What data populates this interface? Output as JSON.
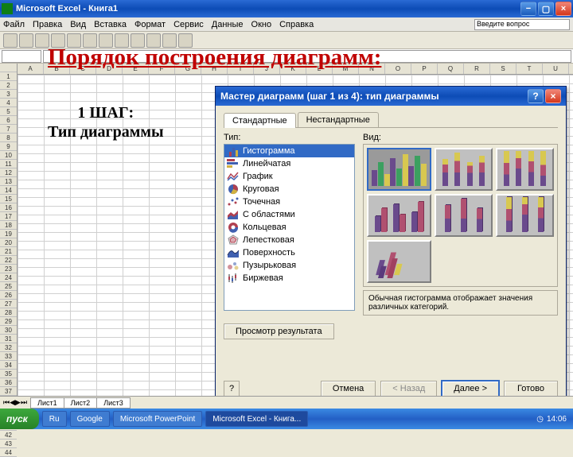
{
  "window": {
    "title": "Microsoft Excel - Книга1",
    "question_dropdown": "Введите вопрос"
  },
  "menu": [
    "Файл",
    "Правка",
    "Вид",
    "Вставка",
    "Формат",
    "Сервис",
    "Данные",
    "Окно",
    "Справка"
  ],
  "columns": [
    "A",
    "B",
    "C",
    "D",
    "E",
    "F",
    "G",
    "H",
    "I",
    "J",
    "K",
    "L",
    "M",
    "N",
    "O",
    "P",
    "Q",
    "R",
    "S",
    "T",
    "U"
  ],
  "slide": {
    "title": "Порядок построения диаграмм:",
    "step1_label": "1 ШАГ:",
    "step1_text": "Тип диаграммы"
  },
  "wizard": {
    "title": "Мастер диаграмм (шаг 1 из 4): тип диаграммы",
    "tabs": {
      "std": "Стандартные",
      "custom": "Нестандартные"
    },
    "labels": {
      "type": "Тип:",
      "view": "Вид:"
    },
    "types": [
      "Гистограмма",
      "Линейчатая",
      "График",
      "Круговая",
      "Точечная",
      "С областями",
      "Кольцевая",
      "Лепестковая",
      "Поверхность",
      "Пузырьковая",
      "Биржевая"
    ],
    "description": "Обычная гистограмма отображает значения различных категорий.",
    "preview_btn": "Просмотр результата",
    "buttons": {
      "cancel": "Отмена",
      "back": "< Назад",
      "next": "Далее >",
      "finish": "Готово"
    }
  },
  "sheets": [
    "Лист1",
    "Лист2",
    "Лист3"
  ],
  "taskbar": {
    "start": "пуск",
    "items": [
      "Ru",
      "Google",
      "Microsoft PowerPoint",
      "Microsoft Excel - Книга..."
    ],
    "time": "14:06"
  }
}
